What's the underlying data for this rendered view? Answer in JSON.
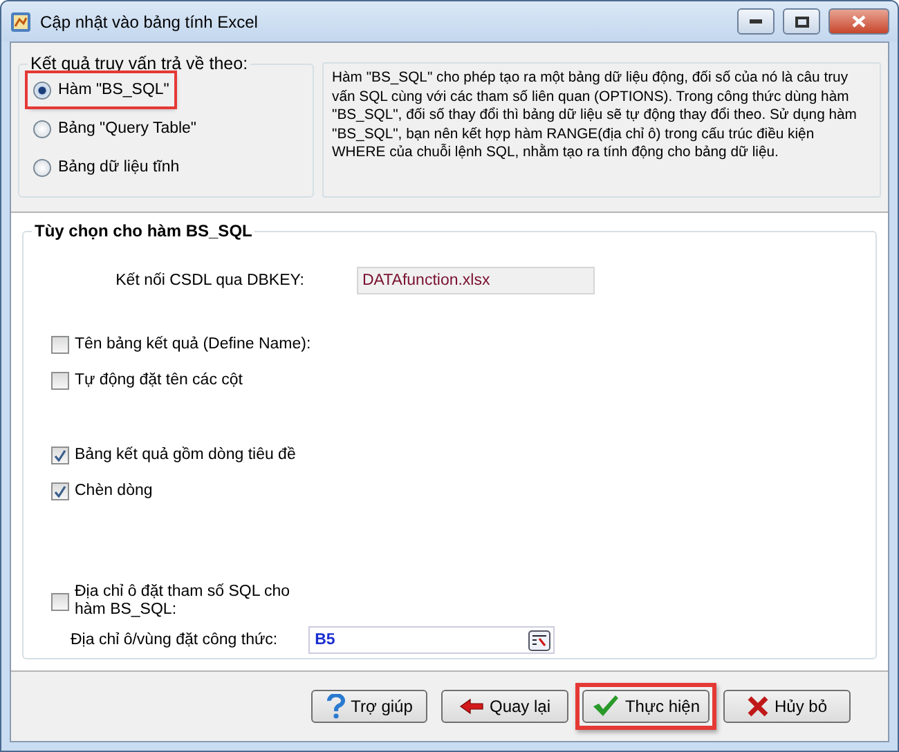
{
  "window": {
    "title": "Cập nhật vào bảng tính Excel"
  },
  "result_group": {
    "legend": "Kết quả truy vấn trả về theo:",
    "options": [
      {
        "label": "Hàm \"BS_SQL\"",
        "selected": true,
        "highlighted": true
      },
      {
        "label": "Bảng \"Query Table\"",
        "selected": false,
        "highlighted": false
      },
      {
        "label": "Bảng dữ liệu tĩnh",
        "selected": false,
        "highlighted": false
      }
    ]
  },
  "description": "Hàm \"BS_SQL\" cho phép tạo ra một bảng dữ liệu động, đối số của nó là câu truy vấn SQL cùng với các tham số liên quan (OPTIONS). Trong công thức dùng hàm \"BS_SQL\", đối số thay đổi thì bảng dữ liệu sẽ tự động thay đổi theo. Sử dụng hàm \"BS_SQL\", bạn nên kết hợp hàm RANGE(địa chỉ ô) trong cấu trúc điều kiện WHERE của chuỗi lệnh SQL, nhằm tạo ra tính động cho bảng dữ liệu.",
  "options_group": {
    "legend": "Tùy chọn cho hàm BS_SQL",
    "sections": [
      [
        {
          "kind": "field",
          "label": "Kết nối CSDL qua DBKEY:",
          "value": "DATAfunction.xlsx"
        }
      ],
      [
        {
          "kind": "checkbox",
          "label": "Tên bảng kết quả (Define Name):",
          "checked": false
        },
        {
          "kind": "checkbox",
          "label": "Tự động đặt tên các cột",
          "checked": false
        }
      ],
      [
        {
          "kind": "checkbox",
          "label": "Bảng kết quả gồm dòng tiêu đề",
          "checked": true
        },
        {
          "kind": "checkbox",
          "label": "Chèn dòng",
          "checked": true
        }
      ],
      [
        {
          "kind": "checkbox",
          "label": "Địa chỉ ô đặt tham số SQL cho hàm BS_SQL:",
          "checked": false
        },
        {
          "kind": "range",
          "label": "Địa chỉ ô/vùng đặt công thức:",
          "value": "B5"
        }
      ]
    ]
  },
  "buttons": [
    {
      "kind": "help",
      "label": "Trợ giúp",
      "highlighted": false
    },
    {
      "kind": "back",
      "label": "Quay lại",
      "highlighted": false
    },
    {
      "kind": "ok",
      "label": "Thực hiện",
      "highlighted": true
    },
    {
      "kind": "cancel",
      "label": "Hủy bỏ",
      "highlighted": false
    }
  ]
}
